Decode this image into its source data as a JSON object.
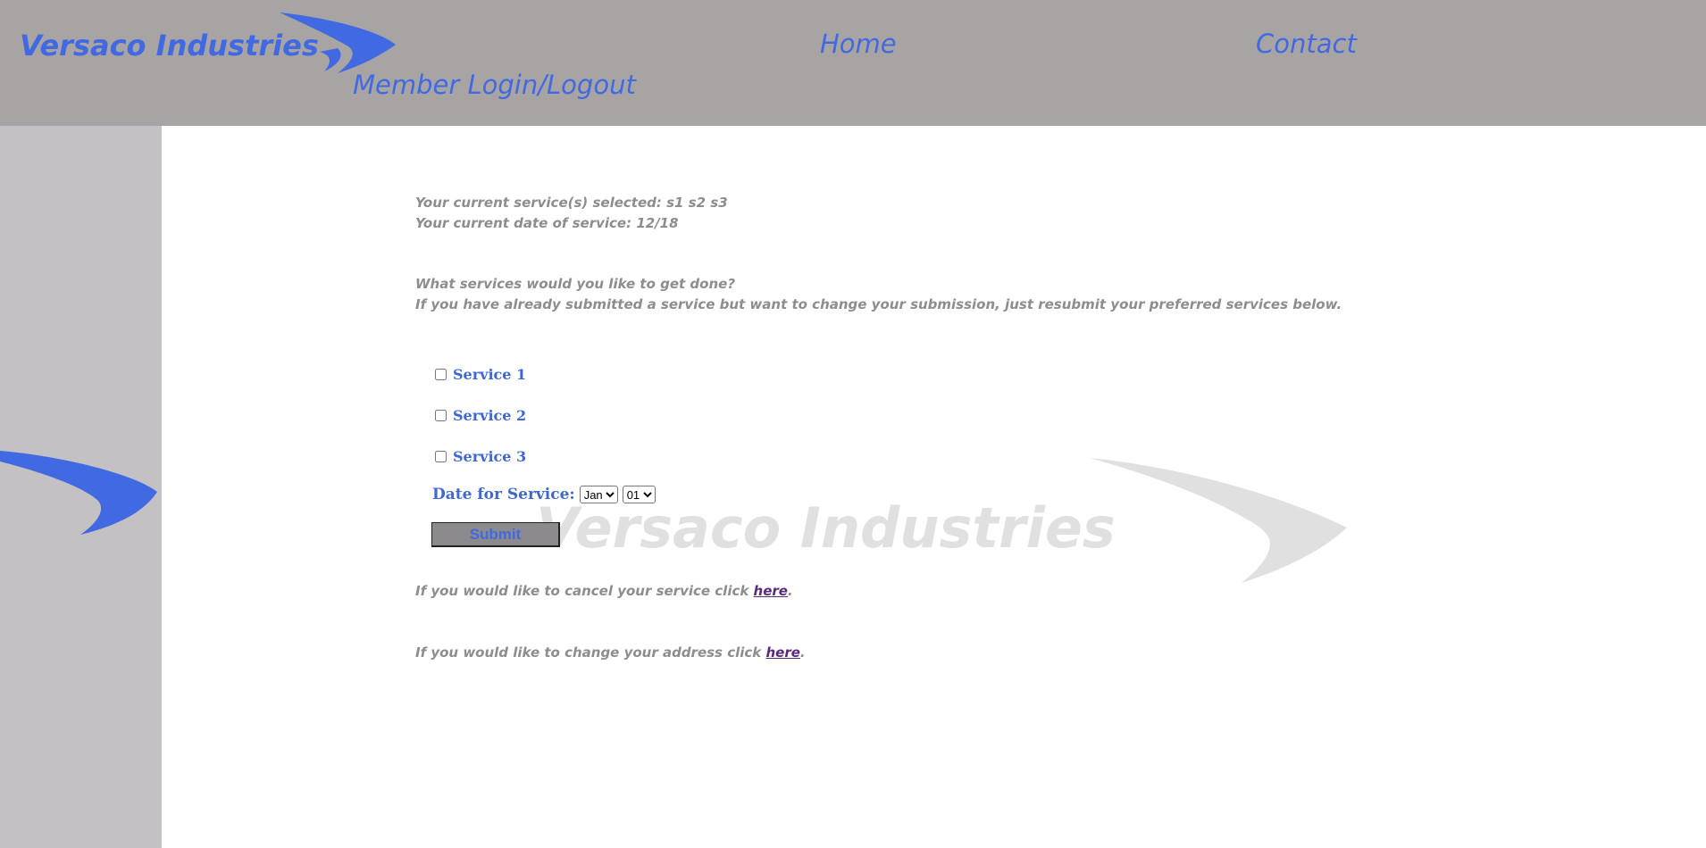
{
  "header": {
    "logo_text": "Versaco Industries",
    "nav": {
      "home": "Home",
      "contact": "Contact",
      "member": "Member Login/Logout"
    }
  },
  "info": {
    "current_services": "Your current service(s) selected: s1 s2 s3",
    "current_date": "Your current date of service: 12/18",
    "question": "What services would you like to get done?",
    "resubmit_note": "If you have already submitted a service but want to change your submission, just resubmit your preferred services below."
  },
  "form": {
    "services": [
      {
        "label": "Service 1",
        "checked": false
      },
      {
        "label": "Service 2",
        "checked": false
      },
      {
        "label": "Service 3",
        "checked": false
      }
    ],
    "date_label": "Date for Service:",
    "month_selected": "Jan",
    "day_selected": "01",
    "submit_label": "Submit"
  },
  "links": {
    "cancel_prefix": "If you would like to cancel your service click ",
    "cancel_link": "here",
    "cancel_suffix": ".",
    "address_prefix": "If you would like to change your address click ",
    "address_link": "here",
    "address_suffix": "."
  },
  "watermark_text": "Versaco Industries",
  "colors": {
    "header_bg": "#a8a4a4",
    "sidebar_bg": "#c3c1c3",
    "brand_blue": "#4169e1",
    "text_gray": "#8d8d8d",
    "link_purple": "#5a2a7a"
  }
}
